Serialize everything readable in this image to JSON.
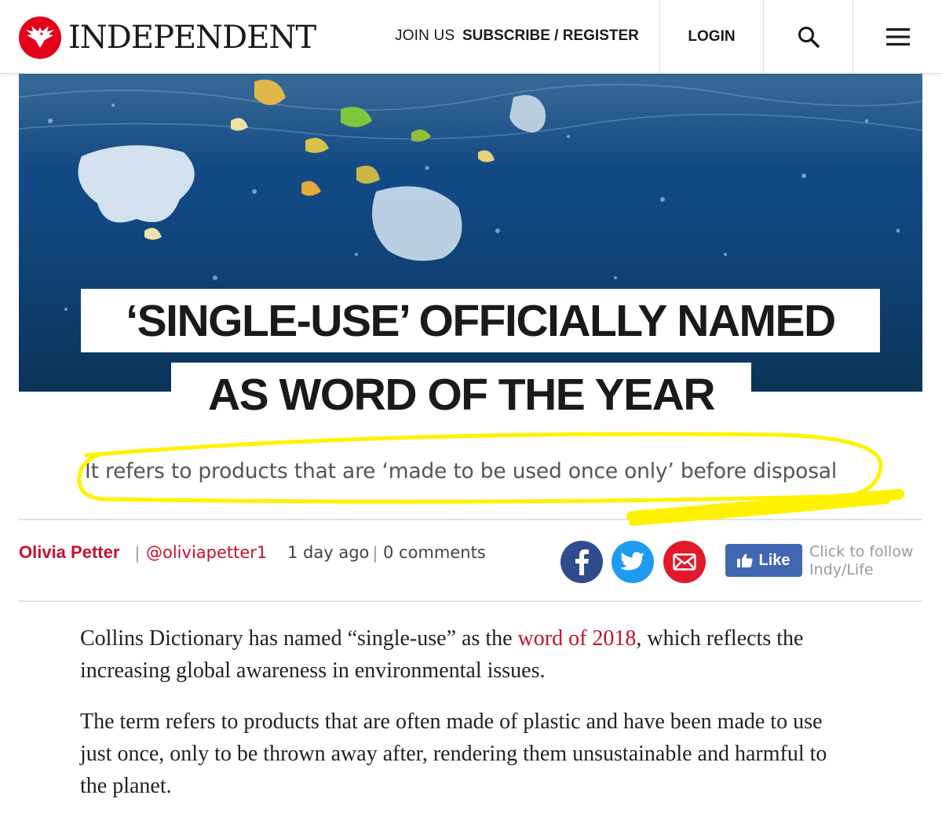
{
  "header": {
    "logo_text": "INDEPENDENT",
    "join_label": "JOIN US",
    "subscribe_label": "SUBSCRIBE / REGISTER",
    "login_label": "LOGIN",
    "search_icon": "search-icon",
    "menu_icon": "hamburger-menu-icon",
    "brand_color": "#e2001a"
  },
  "article": {
    "headline_line1": "‘SINGLE-USE’ OFFICIALLY NAMED",
    "headline_line2": "AS WORD OF THE YEAR",
    "standfirst": "It refers to products that are ‘made to be used once only’ before disposal",
    "author": "Olivia Petter",
    "twitter_handle": "@oliviapetter1",
    "time_ago": "1 day ago",
    "comments": "0 comments",
    "separator": "|",
    "paragraphs": [
      {
        "before": "Collins Dictionary has named “single-use” as the ",
        "link": "word of 2018",
        "after": ", which reflects the increasing global awareness in environmental issues."
      },
      {
        "text": "The term refers to products that are often made of plastic and have been made to use just once, only to be thrown away after, rendering them unsustainable and harmful to the planet."
      }
    ]
  },
  "social": {
    "facebook_icon": "facebook-icon",
    "twitter_icon": "twitter-icon",
    "email_icon": "email-icon",
    "like_label": "Like",
    "follow_line1": "Click to follow",
    "follow_line2": "Indy/Life"
  },
  "colors": {
    "accent_red": "#c8102e",
    "facebook": "#2f4c8f",
    "twitter": "#1d9bf0",
    "email": "#e2192a",
    "like_blue": "#4267b2",
    "highlighter": "#fff200"
  }
}
